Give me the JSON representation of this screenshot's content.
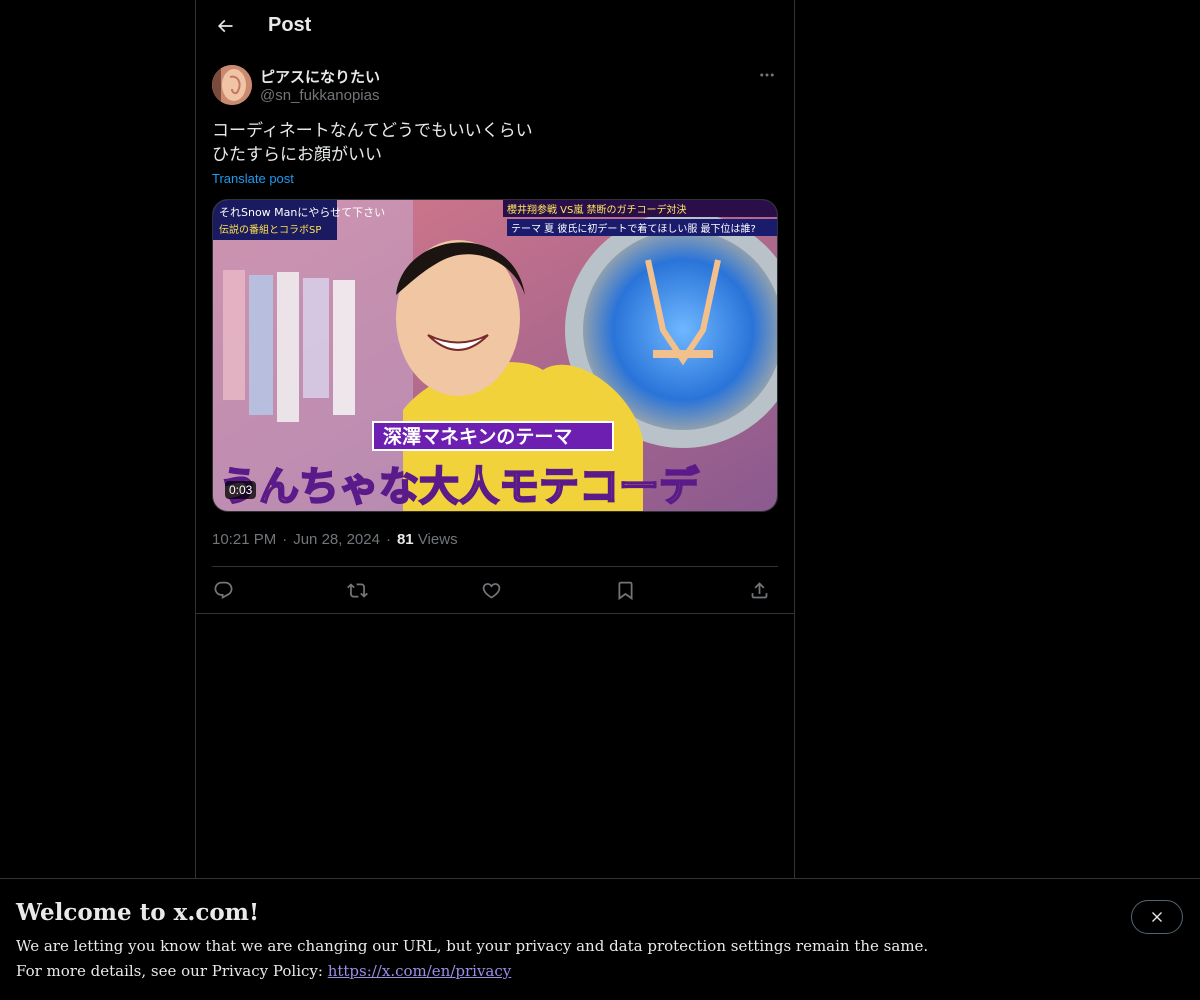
{
  "header": {
    "title": "Post"
  },
  "post": {
    "display_name": "ピアスになりたい",
    "handle": "@sn_fukkanopias",
    "text": "コーディネートなんてどうでもいいくらい\nひたすらにお顔がいい",
    "translate_label": "Translate post",
    "media": {
      "video_time": "0:03",
      "caption_top": "深澤マネキンのテーマ",
      "caption_main": "うんちゃな大人モテコーデ",
      "badge_left_line1": "それSnow Manにやらせて下さい",
      "badge_left_line2": "伝説の番組とコラボSP",
      "badge_right_line1": "櫻井翔参戦 VS嵐 禁断のガチコーデ対決",
      "badge_right_line2": "テーマ 夏 彼氏に初デートで着てほしい服 最下位は誰?"
    },
    "time": "10:21 PM",
    "date": "Jun 28, 2024",
    "views_count": "81",
    "views_label": "Views"
  },
  "actions": {
    "reply": "reply-icon",
    "repost": "repost-icon",
    "like": "like-icon",
    "bookmark": "bookmark-icon",
    "share": "share-icon"
  },
  "banner": {
    "title": "Welcome to x.com!",
    "line1": "We are letting you know that we are changing our URL, but your privacy and data protection settings remain the same.",
    "line2_prefix": "For more details, see our Privacy Policy: ",
    "link_text": "https://x.com/en/privacy"
  },
  "colors": {
    "background": "#000000",
    "text": "#e7e9ea",
    "muted": "#71767b",
    "accent": "#1d9bf0",
    "border": "#2f3336"
  }
}
